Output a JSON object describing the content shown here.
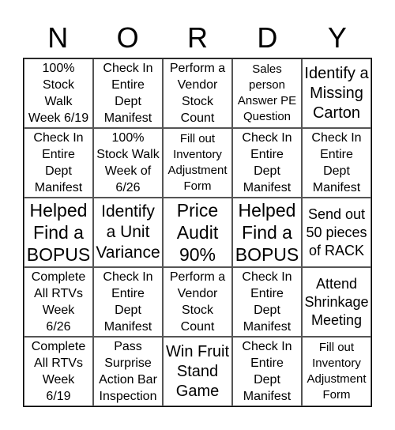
{
  "header": [
    "N",
    "O",
    "R",
    "D",
    "Y"
  ],
  "cells": [
    "100%\nStock\nWalk\nWeek 6/19",
    "Check In\nEntire\nDept\nManifest",
    "Perform a\nVendor\nStock\nCount",
    "Sales\nperson\nAnswer PE\nQuestion",
    "Identify a\nMissing\nCarton",
    "Check In\nEntire\nDept\nManifest",
    "100%\nStock Walk\nWeek of\n6/26",
    "Fill out\nInventory\nAdjustment\nForm",
    "Check In\nEntire\nDept\nManifest",
    "Check In\nEntire\nDept\nManifest",
    "Helped\nFind a\nBOPUS",
    "Identify\na Unit\nVariance",
    "Price\nAudit\n90%",
    "Helped\nFind a\nBOPUS",
    "Send out\n50 pieces\nof RACK",
    "Complete\nAll RTVs\nWeek\n6/26",
    "Check In\nEntire\nDept\nManifest",
    "Perform a\nVendor\nStock\nCount",
    "Check In\nEntire\nDept\nManifest",
    "Attend\nShrinkage\nMeeting",
    "Complete\nAll RTVs\nWeek\n6/19",
    "Pass\nSurprise\nAction Bar\nInspection",
    "Win Fruit\nStand\nGame",
    "Check In\nEntire\nDept\nManifest",
    "Fill out\nInventory\nAdjustment\nForm"
  ]
}
